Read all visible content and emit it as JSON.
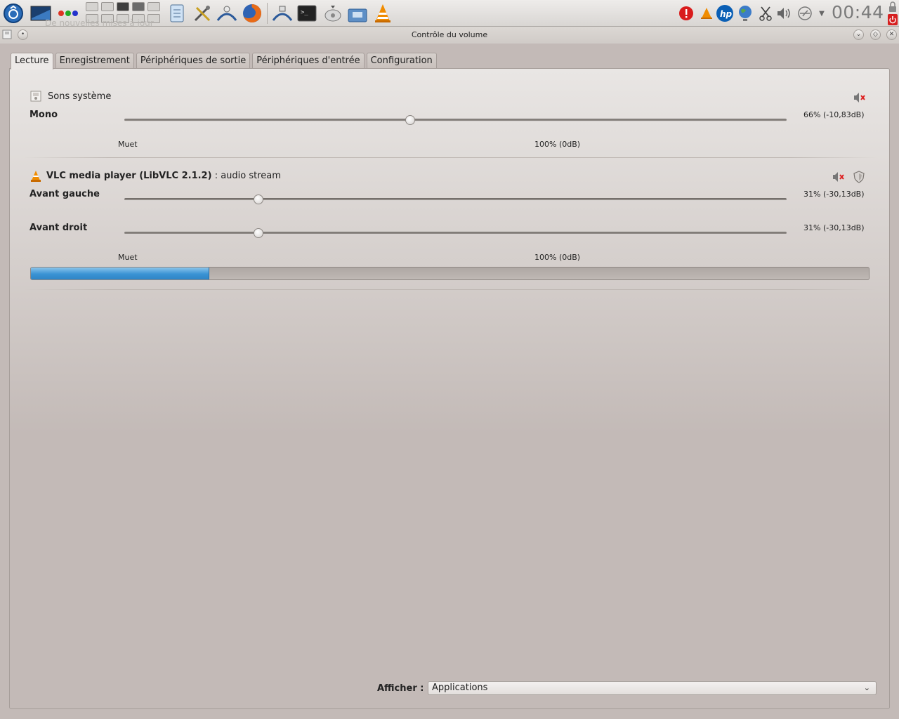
{
  "panel": {
    "ghost_text": "De nouvelles mises à jour",
    "clock": "00:44",
    "launchers": [
      "kde-menu-icon",
      "desktop-icon",
      "activities-icon",
      "notes-icon",
      "tools-icon",
      "network-icon",
      "firefox-icon",
      "dolphin-icon",
      "terminal-icon",
      "disk-icon",
      "share-icon",
      "vlc-icon"
    ],
    "tray": [
      "alert-icon",
      "vlc-tray-icon",
      "hp-icon",
      "globe-icon",
      "scissors-icon",
      "volume-icon",
      "usb-icon",
      "expand-arrow-icon"
    ]
  },
  "window": {
    "title": "Contrôle du volume"
  },
  "tabs": [
    {
      "label": "Lecture",
      "active": true
    },
    {
      "label": "Enregistrement",
      "active": false
    },
    {
      "label": "Périphériques de sortie",
      "active": false
    },
    {
      "label": "Périphériques d'entrée",
      "active": false
    },
    {
      "label": "Configuration",
      "active": false
    }
  ],
  "streams": [
    {
      "name": "Sons système",
      "channels": [
        {
          "label": "Mono",
          "level_percent": 66,
          "readout": "66% (-10,83dB)"
        }
      ],
      "scale_min": "Muet",
      "scale_mid": "100% (0dB)"
    },
    {
      "name_bold": "VLC media player (LibVLC 2.1.2)",
      "name_rest": ": audio stream",
      "channels": [
        {
          "label": "Avant gauche",
          "level_percent": 31,
          "readout": "31% (-30,13dB)"
        },
        {
          "label": "Avant droit",
          "level_percent": 31,
          "readout": "31% (-30,13dB)"
        }
      ],
      "scale_min": "Muet",
      "scale_mid": "100% (0dB)",
      "peak_fraction": 0.213
    }
  ],
  "footer": {
    "show_label": "Afficher :",
    "show_value": "Applications"
  },
  "colors": {
    "accent": "#3a93d4",
    "background": "#c3bab7"
  }
}
